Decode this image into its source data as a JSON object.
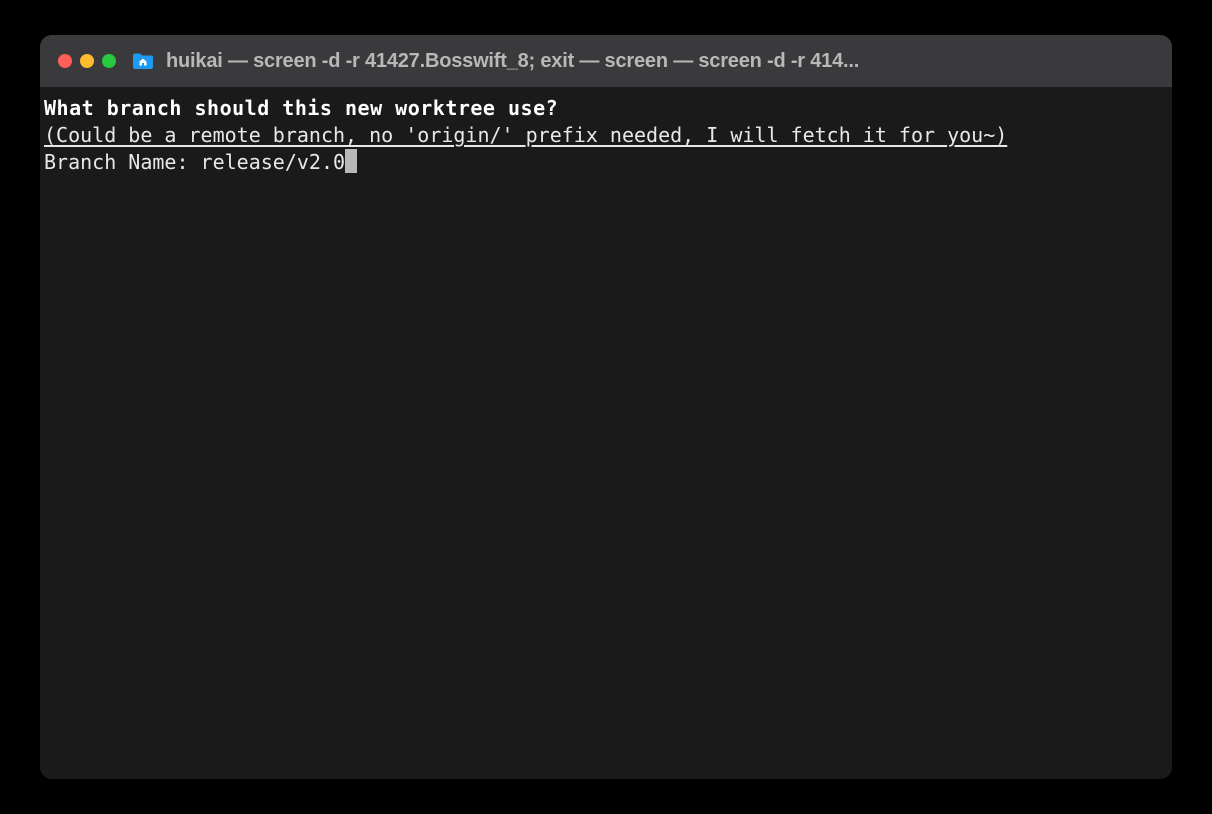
{
  "window": {
    "title": "huikai — screen -d -r 41427.Bosswift_8; exit — screen — screen -d -r 414..."
  },
  "terminal": {
    "prompt_heading": "What branch should this new worktree use?",
    "prompt_hint": "(Could be a remote branch, no 'origin/' prefix needed, I will fetch it for you~)",
    "input_label": "Branch Name: ",
    "input_value": "release/v2.0"
  },
  "icons": {
    "folder": "folder-home-icon"
  }
}
